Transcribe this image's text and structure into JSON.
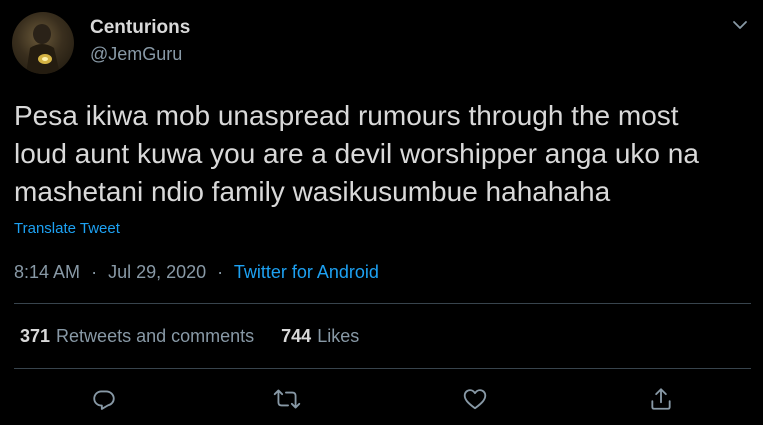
{
  "author": {
    "display_name": "Centurions",
    "handle": "@JemGuru"
  },
  "tweet": {
    "lines": [
      "Pesa ikiwa mob unaspread rumours through the most",
      "loud aunt kuwa you are a devil worshipper anga uko na",
      "mashetani ndio family wasikusumbue hahahaha"
    ],
    "translate_label": "Translate Tweet",
    "time": "8:14 AM",
    "separator": "·",
    "date": "Jul 29, 2020",
    "source": "Twitter for Android"
  },
  "stats": {
    "retweets_count": "371",
    "retweets_label": "Retweets and comments",
    "likes_count": "744",
    "likes_label": "Likes"
  },
  "actions": [
    "reply-icon",
    "retweet-icon",
    "like-icon",
    "share-icon"
  ],
  "colors": {
    "background": "#000000",
    "text": "#d9d9d9",
    "secondary": "#8899a6",
    "accent": "#1da1f2",
    "divider": "#38444d"
  }
}
